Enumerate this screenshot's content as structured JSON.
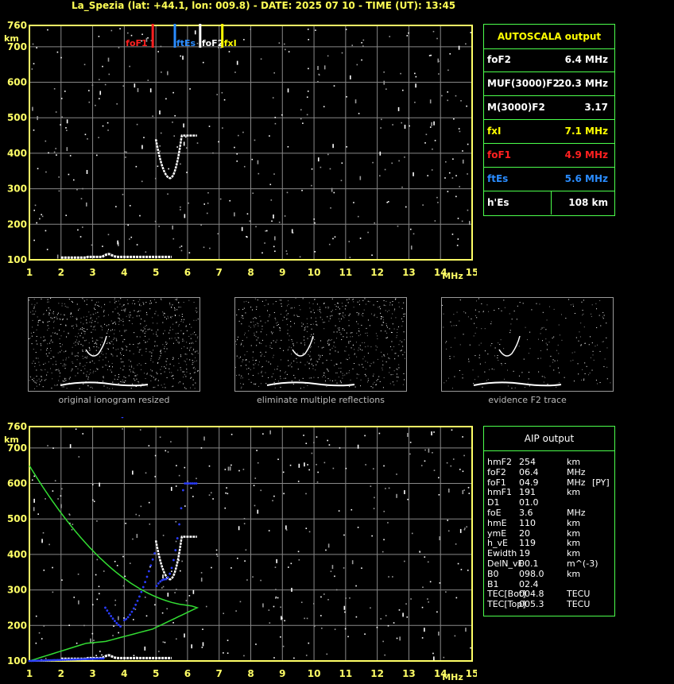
{
  "header": {
    "title": "La_Spezia (lat: +44.1, lon: 009.8) - DATE: 2025 07 10 - TIME (UT): 13:45"
  },
  "ionogram": {
    "y_unit": "km",
    "x_unit": "MHz",
    "y_ticks": [
      "760",
      "700",
      "600",
      "500",
      "400",
      "300",
      "200",
      "100"
    ],
    "x_ticks": [
      "1",
      "2",
      "3",
      "4",
      "5",
      "6",
      "7",
      "8",
      "9",
      "10",
      "11",
      "12",
      "13",
      "14",
      "15"
    ],
    "markers": [
      {
        "label": "foF1",
        "color": "#ff2020"
      },
      {
        "label": "ftEs",
        "color": "#2a8cff"
      },
      {
        "label": "foF2",
        "color": "#ffffff"
      },
      {
        "label": "fxI",
        "color": "#ffff00"
      }
    ]
  },
  "autoscala": {
    "title": "AUTOSCALA output",
    "rows": [
      {
        "label": "foF2",
        "value": "6.4 MHz",
        "color": "#ffffff"
      },
      {
        "label": "MUF(3000)F2",
        "value": "20.3 MHz",
        "color": "#ffffff"
      },
      {
        "label": "M(3000)F2",
        "value": "3.17",
        "color": "#ffffff"
      },
      {
        "label": "fxI",
        "value": "7.1 MHz",
        "color": "#ffff00"
      },
      {
        "label": "foF1",
        "value": "4.9 MHz",
        "color": "#ff2020"
      },
      {
        "label": "ftEs",
        "value": "5.6 MHz",
        "color": "#2a8cff"
      },
      {
        "label": "h'Es",
        "value": "108     km",
        "color": "#ffffff"
      }
    ]
  },
  "thumbnails": {
    "captions": [
      "original ionogram resized",
      "eliminate multiple reflections",
      "evidence F2 trace"
    ]
  },
  "aip": {
    "title": "AIP output",
    "rows": [
      {
        "name": "hmF2",
        "value": "254",
        "unit": "km",
        "extra": ""
      },
      {
        "name": "foF2",
        "value": "06.4",
        "unit": "MHz",
        "extra": ""
      },
      {
        "name": "foF1",
        "value": "04.9",
        "unit": "MHz",
        "extra": "[PY]"
      },
      {
        "name": "hmF1",
        "value": "191",
        "unit": "km",
        "extra": ""
      },
      {
        "name": "D1",
        "value": "01.0",
        "unit": "",
        "extra": ""
      },
      {
        "name": "foE",
        "value": "3.6",
        "unit": "MHz",
        "extra": ""
      },
      {
        "name": "hmE",
        "value": "110",
        "unit": "km",
        "extra": ""
      },
      {
        "name": "ymE",
        "value": "20",
        "unit": "km",
        "extra": ""
      },
      {
        "name": "h_vE",
        "value": "119",
        "unit": "km",
        "extra": ""
      },
      {
        "name": "Ewidth",
        "value": "19",
        "unit": "km",
        "extra": ""
      },
      {
        "name": "DelN_vE",
        "value": "00.1",
        "unit": "m^(-3)",
        "extra": ""
      },
      {
        "name": "B0",
        "value": "098.0",
        "unit": "km",
        "extra": ""
      },
      {
        "name": "B1",
        "value": "02.4",
        "unit": "",
        "extra": ""
      },
      {
        "name": "TEC[Bot]",
        "value": "004.8",
        "unit": "TECU",
        "extra": ""
      },
      {
        "name": "TEC[Top]",
        "value": "005.3",
        "unit": "TECU",
        "extra": ""
      }
    ]
  },
  "colors": {
    "frame": "#ffff66",
    "grid": "#888888",
    "panel_border": "#4cff4c",
    "profile": "#33dd33",
    "fit": "#2a3cff"
  }
}
